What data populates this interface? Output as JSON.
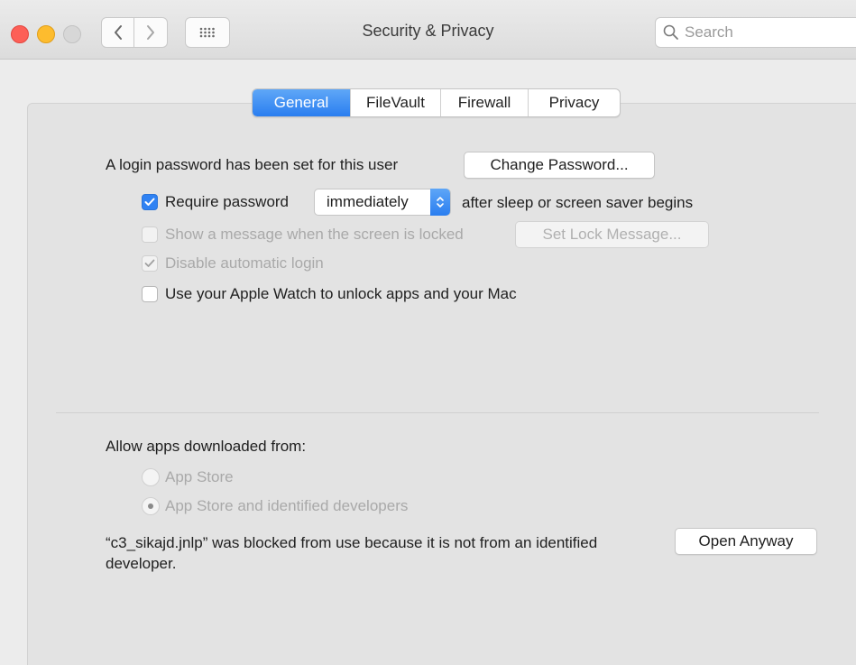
{
  "window": {
    "title": "Security & Privacy",
    "search_placeholder": "Search"
  },
  "tabs": [
    {
      "label": "General",
      "active": true
    },
    {
      "label": "FileVault",
      "active": false
    },
    {
      "label": "Firewall",
      "active": false
    },
    {
      "label": "Privacy",
      "active": false
    }
  ],
  "general": {
    "login_password_text": "A login password has been set for this user",
    "change_password_label": "Change Password...",
    "require_password": {
      "label": "Require password",
      "checked": true
    },
    "require_password_delay": "immediately",
    "require_password_suffix": "after sleep or screen saver begins",
    "show_message": {
      "label": "Show a message when the screen is locked",
      "checked": false,
      "enabled": false
    },
    "set_lock_message_label": "Set Lock Message...",
    "disable_auto_login": {
      "label": "Disable automatic login",
      "checked": true,
      "enabled": false
    },
    "apple_watch": {
      "label": "Use your Apple Watch to unlock apps and your Mac",
      "checked": false
    },
    "allow_apps_heading": "Allow apps downloaded from:",
    "app_sources": [
      {
        "label": "App Store",
        "selected": false
      },
      {
        "label": "App Store and identified developers",
        "selected": true
      }
    ],
    "blocked_message": "“c3_sikajd.jnlp” was blocked from use because it is not from an identified developer.",
    "open_anyway_label": "Open Anyway"
  },
  "colors": {
    "accent": "#2f82f3",
    "traffic_red": "#fd5f57",
    "traffic_yellow": "#fdbc2e",
    "traffic_inactive": "#d7d7d7"
  }
}
